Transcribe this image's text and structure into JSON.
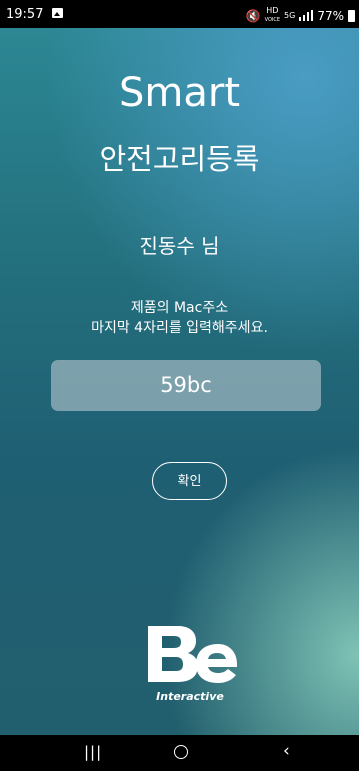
{
  "status_bar": {
    "time": "19:57",
    "hd_label": "HD",
    "voice_label": "VOICE",
    "lte_label": "5G",
    "battery": "77%"
  },
  "header": {
    "title": "Smart",
    "subtitle": "안전고리등록"
  },
  "user": {
    "name": "진동수 님"
  },
  "instruction": {
    "line1": "제품의 Mac주소",
    "line2": "마지막 4자리를 입력해주세요."
  },
  "mac_input": {
    "value": "59bc"
  },
  "confirm_button": {
    "label": "확인"
  },
  "logo": {
    "main": "Be",
    "sub": "Interactive"
  },
  "colors": {
    "accent": "#2d8a96",
    "text": "#ffffff"
  },
  "nav_icons": [
    "recent-apps-icon",
    "home-icon",
    "back-icon"
  ]
}
